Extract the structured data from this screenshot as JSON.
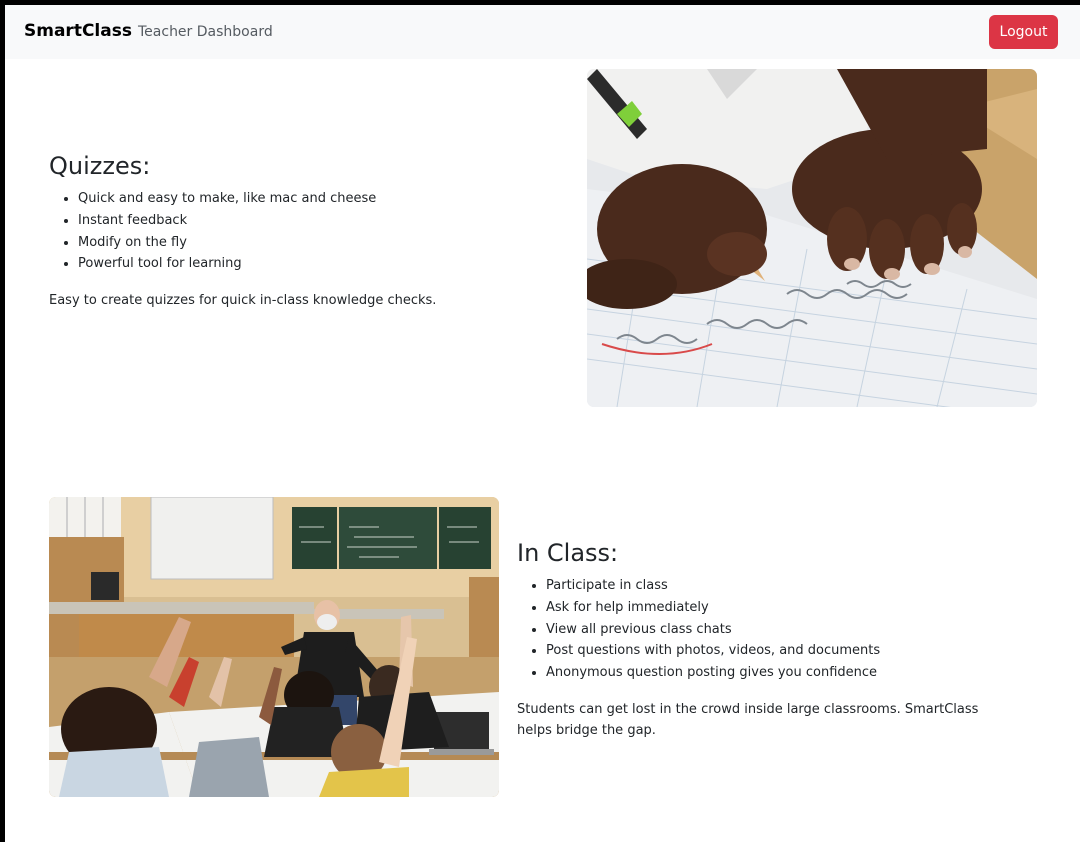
{
  "navbar": {
    "brand": "SmartClass",
    "link": "Teacher Dashboard",
    "logout_label": "Logout"
  },
  "quizzes": {
    "heading": "Quizzes:",
    "items": [
      "Quick and easy to make, like mac and cheese",
      "Instant feedback",
      "Modify on the fly",
      "Powerful tool for learning"
    ],
    "description": "Easy to create quizzes for quick in-class knowledge checks."
  },
  "in_class": {
    "heading": "In Class:",
    "items": [
      "Participate in class",
      "Ask for help immediately",
      "View all previous class chats",
      "Post questions with photos, videos, and documents",
      "Anonymous question posting gives you confidence"
    ],
    "description": "Students can get lost in the crowd inside large classrooms. SmartClass helps bridge the gap."
  },
  "colors": {
    "navbar_bg": "#f8f9fa",
    "logout_bg": "#dc3545",
    "text": "#212529"
  }
}
